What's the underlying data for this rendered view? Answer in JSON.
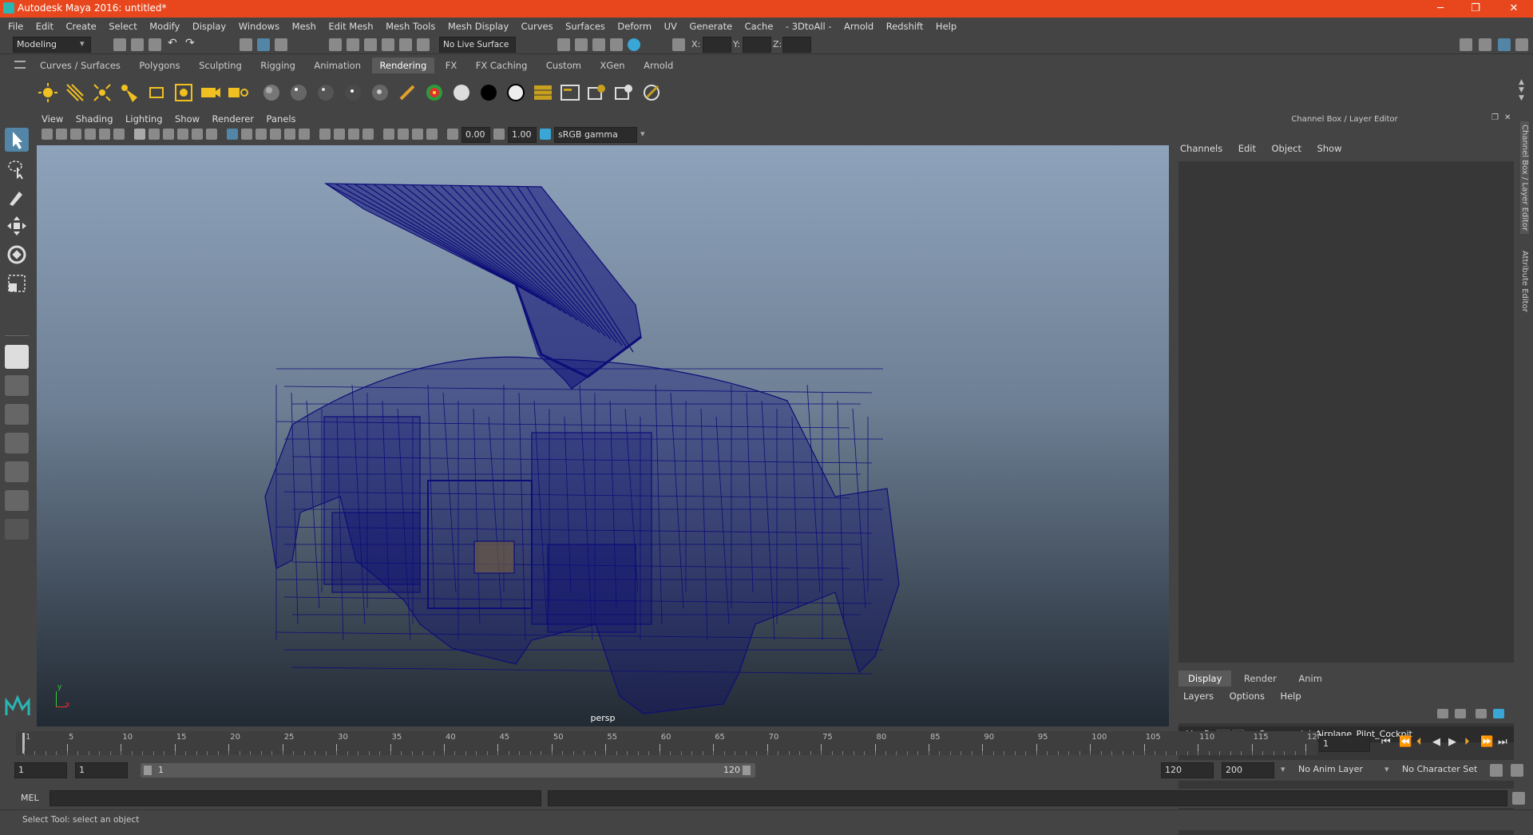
{
  "window": {
    "title": "Autodesk Maya 2016: untitled*",
    "controls": {
      "minimize": "─",
      "maximize": "❐",
      "close": "✕"
    }
  },
  "menubar": {
    "items": [
      "File",
      "Edit",
      "Create",
      "Select",
      "Modify",
      "Display",
      "Windows",
      "Mesh",
      "Edit Mesh",
      "Mesh Tools",
      "Mesh Display",
      "Curves",
      "Surfaces",
      "Deform",
      "UV",
      "Generate",
      "Cache",
      "- 3DtoAll -",
      "Arnold",
      "Redshift",
      "Help"
    ]
  },
  "statusline": {
    "mode": "Modeling",
    "live_surface": "No Live Surface",
    "x_label": "X:",
    "y_label": "Y:",
    "z_label": "Z:"
  },
  "shelf": {
    "tabs": [
      "Curves / Surfaces",
      "Polygons",
      "Sculpting",
      "Rigging",
      "Animation",
      "Rendering",
      "FX",
      "FX Caching",
      "Custom",
      "XGen",
      "Arnold"
    ],
    "active_tab": "Rendering"
  },
  "viewport": {
    "menus": [
      "View",
      "Shading",
      "Lighting",
      "Show",
      "Renderer",
      "Panels"
    ],
    "exposure": "0.00",
    "gamma": "1.00",
    "color_space": "sRGB gamma",
    "camera_label": "persp",
    "axis_y": "y",
    "axis_x": "x"
  },
  "right_panel": {
    "title": "Channel Box / Layer Editor",
    "menus": [
      "Channels",
      "Edit",
      "Object",
      "Show"
    ],
    "layer_tabs": [
      "Display",
      "Render",
      "Anim"
    ],
    "active_layer_tab": "Display",
    "layer_menus": [
      "Layers",
      "Options",
      "Help"
    ],
    "layer": {
      "v": "V",
      "p": "P",
      "name": "...:Commercial_Airplane_Pilot_Cockpit"
    },
    "side_tabs": [
      "Channel Box / Layer Editor",
      "Attribute Editor"
    ]
  },
  "timeline": {
    "ticks": [
      "1",
      "5",
      "10",
      "15",
      "20",
      "25",
      "30",
      "35",
      "40",
      "45",
      "50",
      "55",
      "60",
      "65",
      "70",
      "75",
      "80",
      "85",
      "90",
      "95",
      "100",
      "105",
      "110",
      "115",
      "120"
    ],
    "current_frame": "1"
  },
  "range": {
    "start": "1",
    "start_playback": "1",
    "slider_start": "1",
    "slider_end": "120",
    "end_playback": "120",
    "end": "200",
    "anim_layer": "No Anim Layer",
    "character_set": "No Character Set"
  },
  "cmdline": {
    "label": "MEL"
  },
  "helpline": {
    "text": "Select Tool: select an object"
  },
  "colors": {
    "titlebar": "#e8471d",
    "wireframe": "#0d0d78",
    "ui_bg": "#444444"
  }
}
